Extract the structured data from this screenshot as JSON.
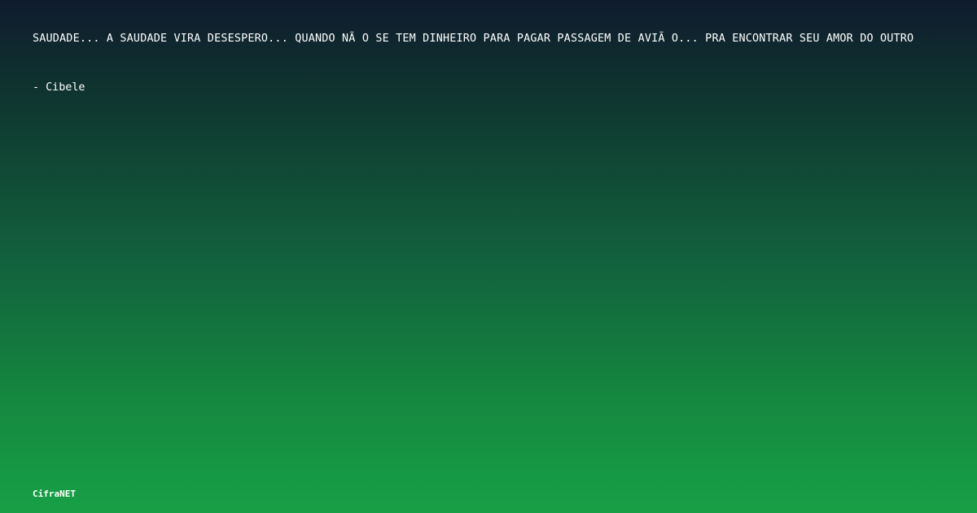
{
  "quote": {
    "text": "SAUDADE... A SAUDADE VIRA DESESPERO... QUANDO NÃ O SE TEM DINHEIRO PARA PAGAR PASSAGEM DE AVIÃ O... PRA ENCONTRAR SEU AMOR DO OUTRO",
    "author": "- Cibele"
  },
  "brand": {
    "name": "CifraNET"
  },
  "colors": {
    "background_top": "#0f1b2d",
    "background_bottom": "#17a046",
    "text": "#ffffff"
  }
}
